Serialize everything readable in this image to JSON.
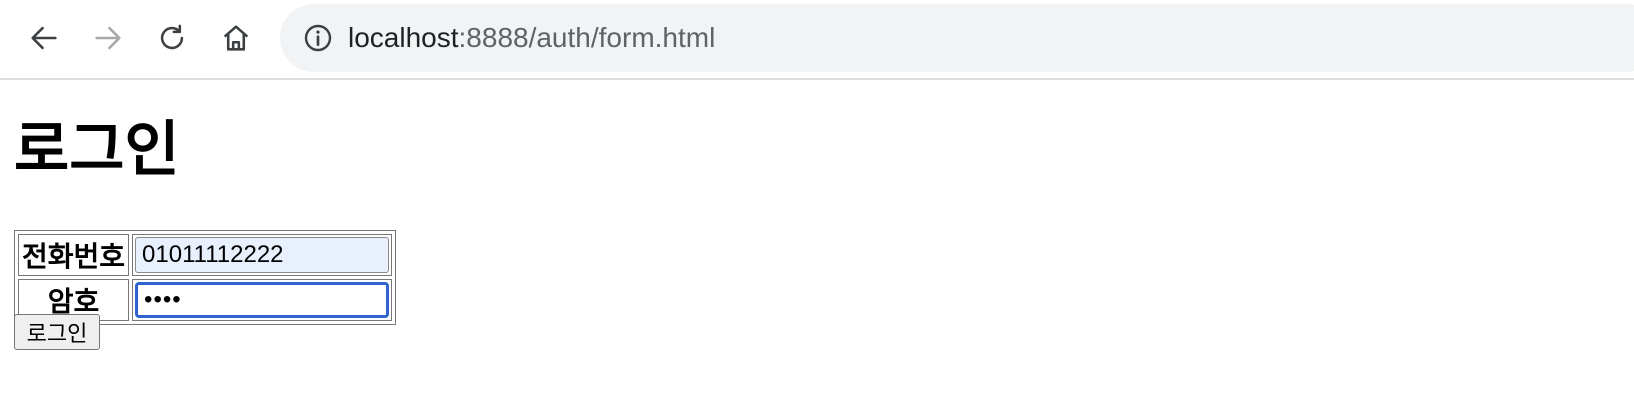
{
  "browser": {
    "url_host": "localhost",
    "url_path": ":8888/auth/form.html",
    "icons": [
      "back-arrow-icon",
      "forward-arrow-icon",
      "reload-icon",
      "home-icon",
      "info-icon"
    ]
  },
  "page": {
    "title": "로그인",
    "form": {
      "phone_label": "전화번호",
      "phone_value": "01011112222",
      "password_label": "암호",
      "password_value": "1234",
      "submit_label": "로그인"
    }
  },
  "colors": {
    "autofill_bg": "#e8f0fe",
    "focus_border": "#2f63d0",
    "omnibox_bg": "#f1f3f4"
  }
}
